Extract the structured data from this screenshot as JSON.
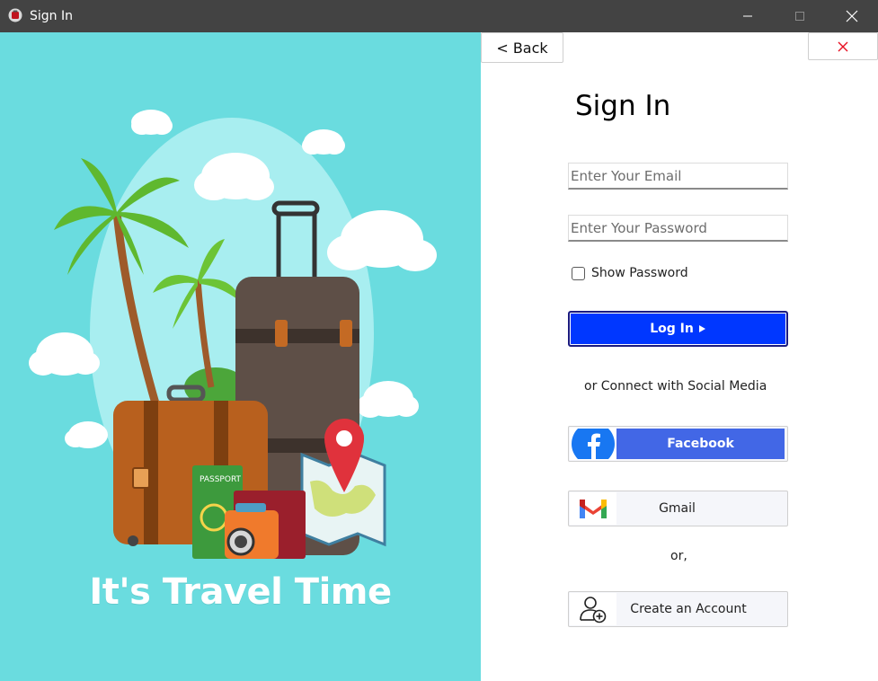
{
  "window": {
    "title": "Sign In",
    "icon": "app-icon"
  },
  "hero": {
    "caption": "It's Travel Time",
    "background_color": "#6adcdf"
  },
  "nav": {
    "back_label": "< Back",
    "close_icon": "close-icon"
  },
  "form": {
    "title": "Sign In",
    "email": {
      "placeholder": "Enter Your Email",
      "value": ""
    },
    "password": {
      "placeholder": "Enter Your Password",
      "value": ""
    },
    "show_password": {
      "label": "Show Password",
      "checked": false
    },
    "login_label": "Log In",
    "login_icon": "arrow-right-icon"
  },
  "social": {
    "heading": "or Connect with Social Media",
    "facebook_label": "Facebook",
    "gmail_label": "Gmail",
    "or_label": "or,",
    "create_label": "Create an Account"
  },
  "colors": {
    "titlebar": "#434343",
    "primary": "#0037ff",
    "facebook": "#4267e6",
    "close_red": "#e81123"
  }
}
